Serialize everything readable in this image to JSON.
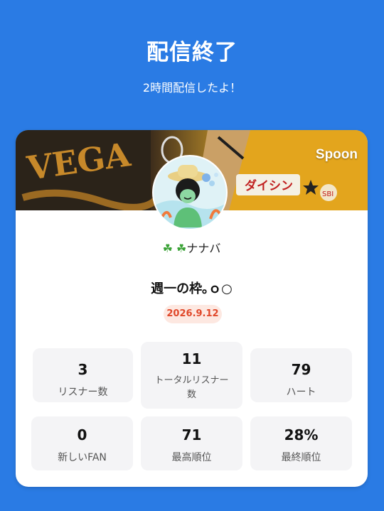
{
  "header": {
    "title": "配信終了",
    "subtitle": "2時間配信したよ！"
  },
  "card": {
    "brand": "Spoon",
    "banner_text": "VEGA",
    "banner_sign": "ダイシン",
    "user_name": "☘️🍀ナナバ",
    "clover_icons": "☘ ☘",
    "name_text": "ナナバ",
    "stream_title": "週一の枠｡ｏ○",
    "date": "2026.9.12",
    "colors": {
      "background": "#2a7be4",
      "date_text": "#e0482a",
      "date_bg": "#fde8e1"
    }
  },
  "stats": [
    {
      "value": "3",
      "label": "リスナー数"
    },
    {
      "value": "11",
      "label": "トータルリスナー数"
    },
    {
      "value": "79",
      "label": "ハート"
    },
    {
      "value": "0",
      "label": "新しいFAN"
    },
    {
      "value": "71",
      "label": "最高順位"
    },
    {
      "value": "28%",
      "label": "最終順位"
    }
  ]
}
